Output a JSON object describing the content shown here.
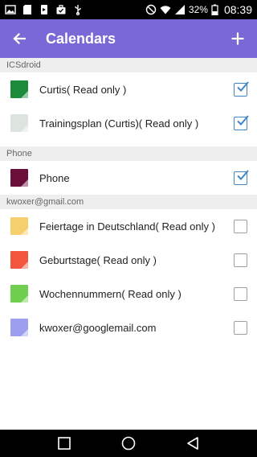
{
  "status_bar": {
    "battery_percent": "32%",
    "time": "08:39",
    "left_icons": [
      "image-icon",
      "sd-card-icon",
      "usb-debug-icon",
      "briefcase-icon",
      "usb-icon"
    ],
    "right_icons": [
      "no-disturb-icon",
      "wifi-icon",
      "signal-icon",
      "battery-icon"
    ]
  },
  "app_bar": {
    "title": "Calendars",
    "color": "#7a68d6",
    "back_icon": "arrow-left-icon",
    "add_icon": "plus-icon"
  },
  "sections": [
    {
      "header": "ICSdroid",
      "calendars": [
        {
          "label": "Curtis( Read only )",
          "color": "#1b8a3a",
          "checked": true
        },
        {
          "label": "Trainingsplan (Curtis)( Read only )",
          "color": "#dde3df",
          "checked": true
        }
      ]
    },
    {
      "header": "Phone",
      "calendars": [
        {
          "label": "Phone",
          "color": "#6b0f3a",
          "checked": true
        }
      ]
    },
    {
      "header": "kwoxer@gmail.com",
      "calendars": [
        {
          "label": "Feiertage in Deutschland( Read only )",
          "color": "#f5cf6b",
          "checked": false
        },
        {
          "label": "Geburtstage( Read only )",
          "color": "#f2553c",
          "checked": false
        },
        {
          "label": "Wochennummern( Read only )",
          "color": "#6fce4e",
          "checked": false
        },
        {
          "label": "kwoxer@googlemail.com",
          "color": "#9c9ef0",
          "checked": false
        }
      ]
    }
  ],
  "nav_bar": {
    "icons": [
      "recents-square-icon",
      "home-circle-icon",
      "back-triangle-icon"
    ]
  }
}
